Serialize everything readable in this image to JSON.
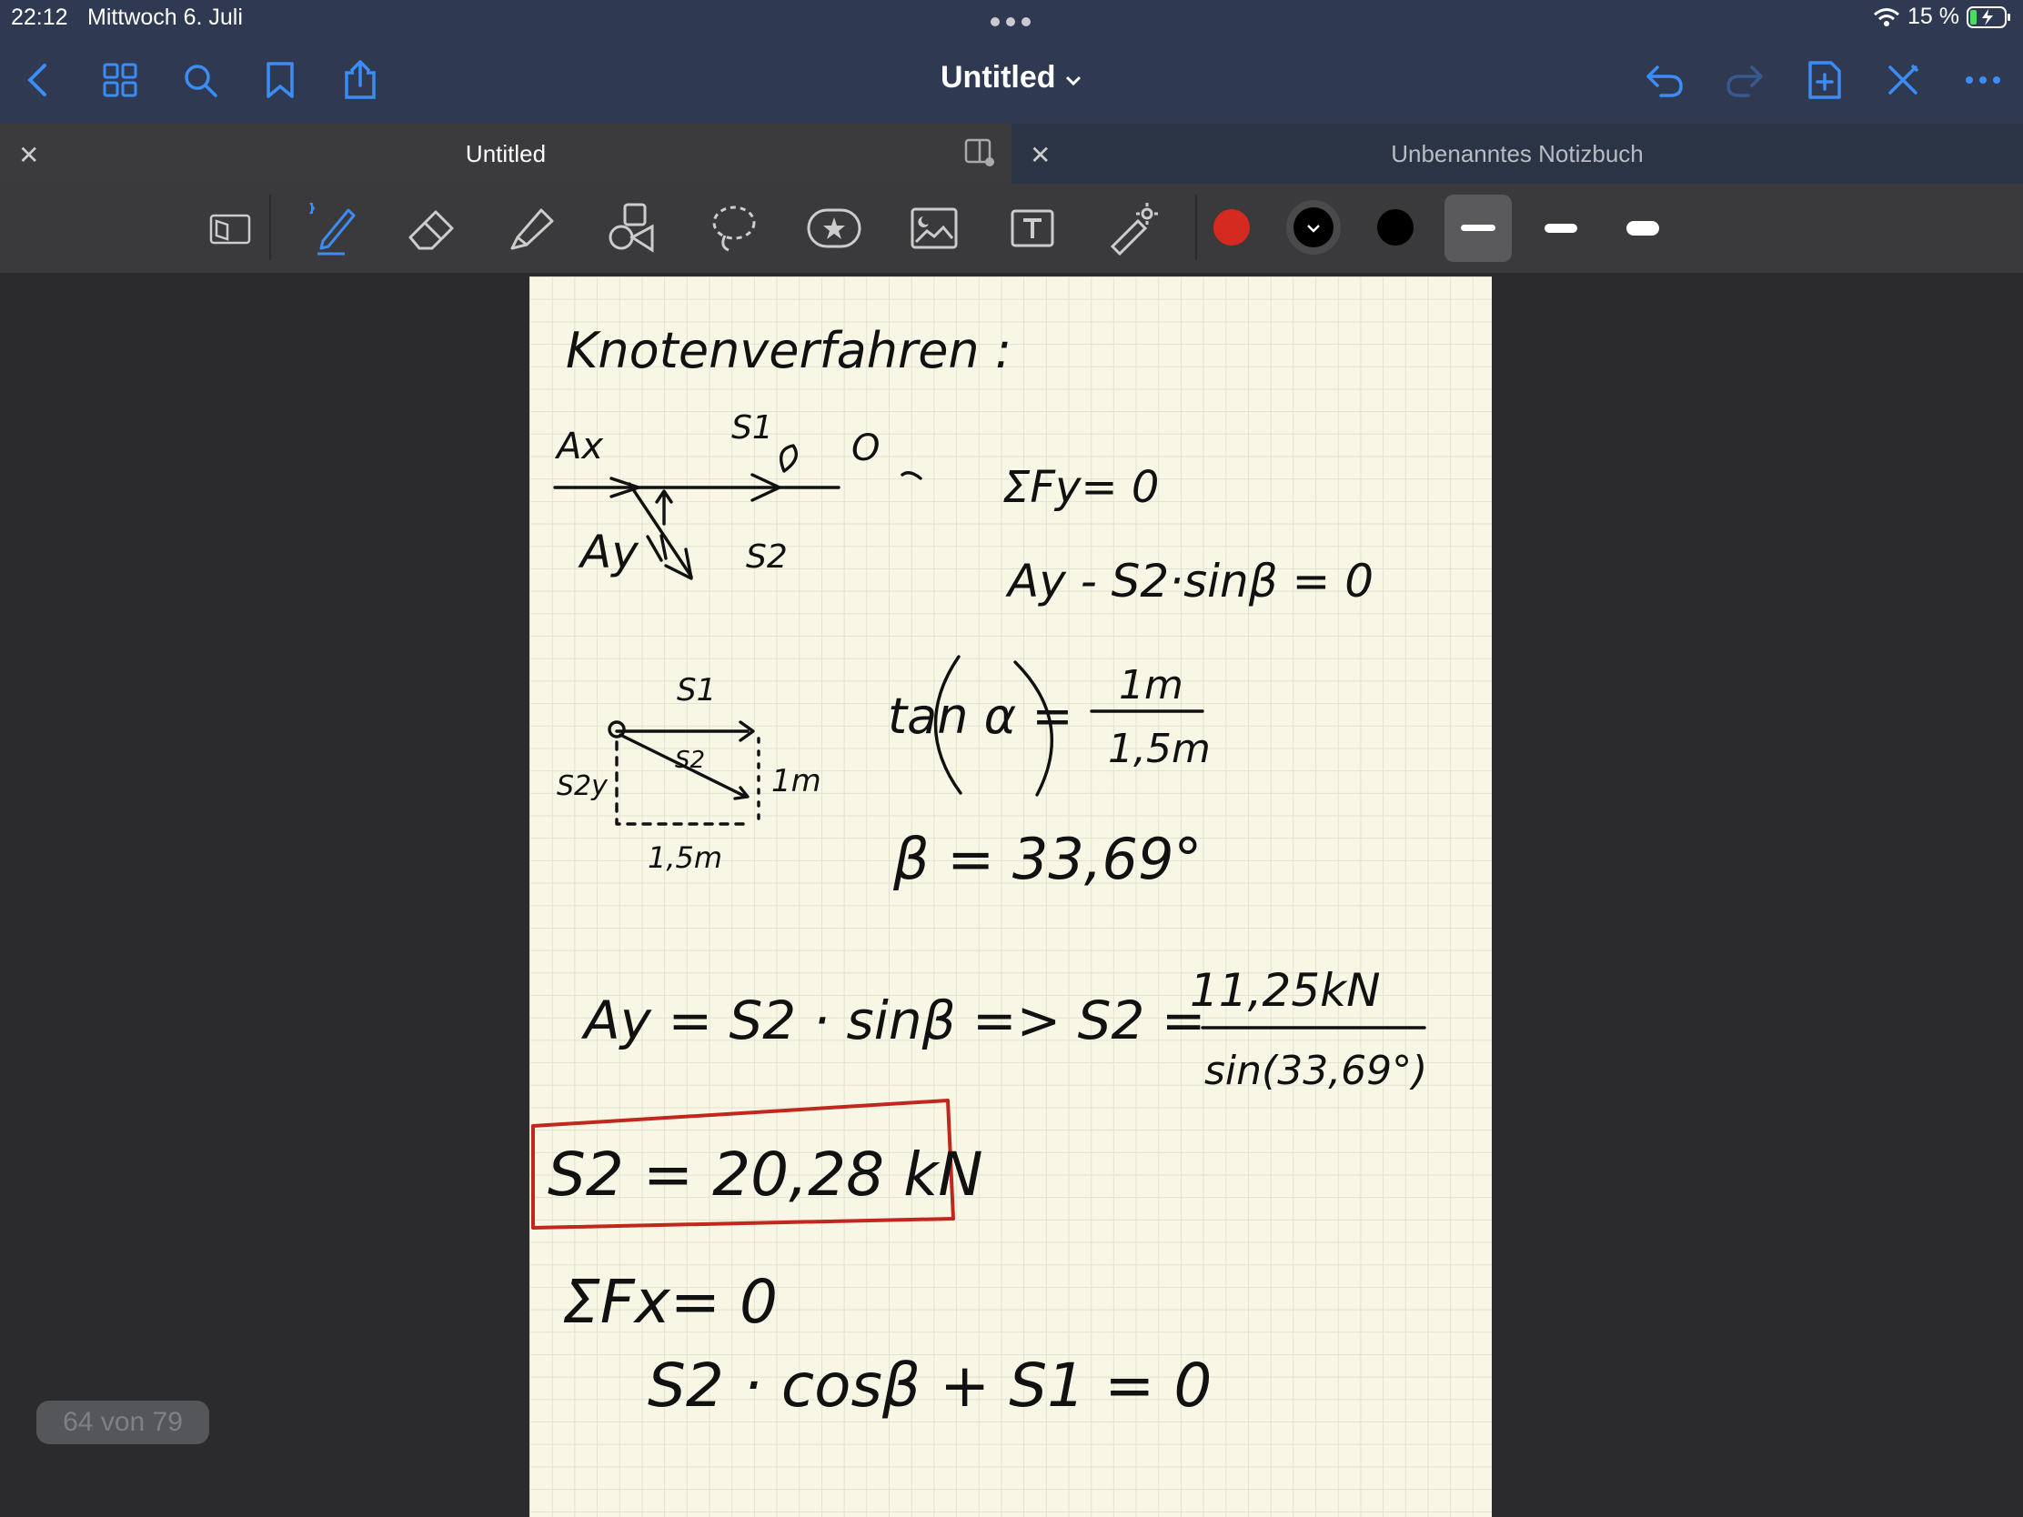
{
  "status": {
    "time": "22:12",
    "date": "Mittwoch 6. Juli",
    "battery": "15 %"
  },
  "nav": {
    "title": "Untitled",
    "accent": "#3c8cf5"
  },
  "tabs": {
    "left": "Untitled",
    "right": "Unbenanntes Notizbuch"
  },
  "toolbar": {
    "colors": [
      "#d42a20",
      "#000000",
      "#000000"
    ]
  },
  "note": {
    "heading": "Knotenverfahren :",
    "sketch1": {
      "ax": "Ax",
      "s1": "S1",
      "o": "O",
      "ay": "Ay",
      "s2": "S2"
    },
    "eq_sum_fy": "ΣFy= 0",
    "eq_ay_minus": "Ay - S2·sinβ = 0",
    "sketch2": {
      "s1": "S1",
      "s2": "S2",
      "s2y": "S2y",
      "height": "1m",
      "width": "1,5m"
    },
    "eq_tan_lhs": "tan α =",
    "eq_tan_num": "1m",
    "eq_tan_den": "1,5m",
    "eq_beta": "β = 33,69°",
    "eq_ay_lhs": "Ay = S2 · sinβ => S2 =",
    "eq_frac_num": "11,25kN",
    "eq_frac_den": "sin(33,69°)",
    "eq_result": "S2 = 20,28 kN",
    "eq_sum_fx": "ΣFx= 0",
    "eq_last": "S2 · cosβ + S1 = 0"
  },
  "page_indicator": "64 von 79"
}
